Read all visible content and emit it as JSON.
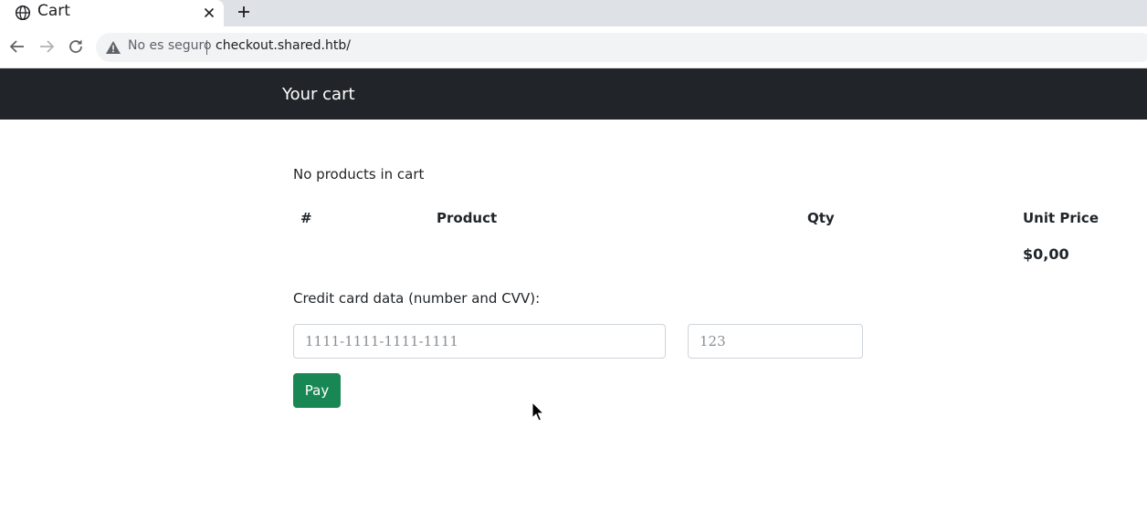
{
  "browser": {
    "tab_title": "Cart",
    "security_label": "No es seguro",
    "url": "checkout.shared.htb/"
  },
  "navbar": {
    "brand": "Your cart"
  },
  "cart": {
    "empty_message": "No products in cart",
    "columns": [
      "#",
      "Product",
      "Qty",
      "Unit Price"
    ],
    "total": "$0,00"
  },
  "payment": {
    "label": "Credit card data (number and CVV):",
    "card_number_placeholder": "1111-1111-1111-1111",
    "cvv_placeholder": "123",
    "pay_label": "Pay"
  },
  "colors": {
    "navbar_bg": "#212529",
    "pay_button": "#198754"
  }
}
